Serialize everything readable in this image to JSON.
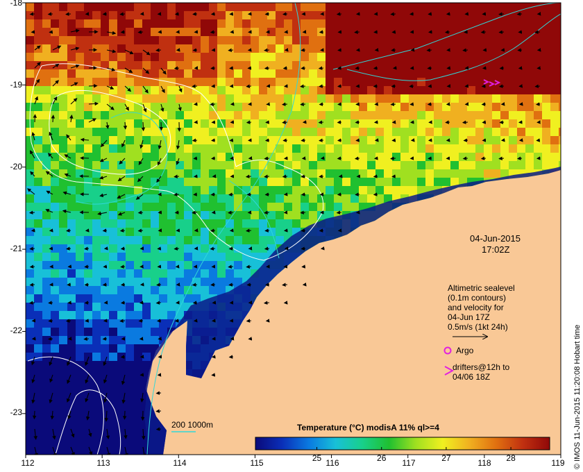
{
  "map": {
    "lat_labels": [
      "-18",
      "-19",
      "-20",
      "-21",
      "-22",
      "-23"
    ],
    "lon_labels": [
      "112",
      "113",
      "114",
      "115",
      "116",
      "117",
      "118",
      "119"
    ],
    "lat_range": [
      -23.5,
      -18
    ],
    "lon_range": [
      112,
      119
    ],
    "date": "04-Jun-2015",
    "time": "17:02Z",
    "land_color": "#f9c896"
  },
  "legend": {
    "altimetry_lines": [
      "Altimetric sealevel",
      "(0.1m contours)",
      "and velocity for",
      "04-Jun 17Z",
      "0.5m/s  (1kt 24h)"
    ],
    "argo_label": "Argo",
    "drifters_lines": [
      "drifters@12h to",
      "04/06 18Z"
    ],
    "contour_label": "200  1000m",
    "marker_color": "#e020e0"
  },
  "colorbar": {
    "title": "Temperature (°C) modisA 11% ql>=4",
    "ticks": [
      "25",
      "26",
      "27",
      "28"
    ],
    "tick_values": [
      25,
      26,
      27,
      28
    ],
    "range": [
      24.05,
      28.6
    ],
    "colors": [
      "#0a0a7a",
      "#0a2fb8",
      "#0a7ae0",
      "#18c0d8",
      "#18d08a",
      "#20c030",
      "#a0e020",
      "#f0f020",
      "#f0b020",
      "#e07010",
      "#c03010",
      "#900808"
    ]
  },
  "credit": "© IMOS 11-Jun-2015 11:20:08 Hobart time"
}
